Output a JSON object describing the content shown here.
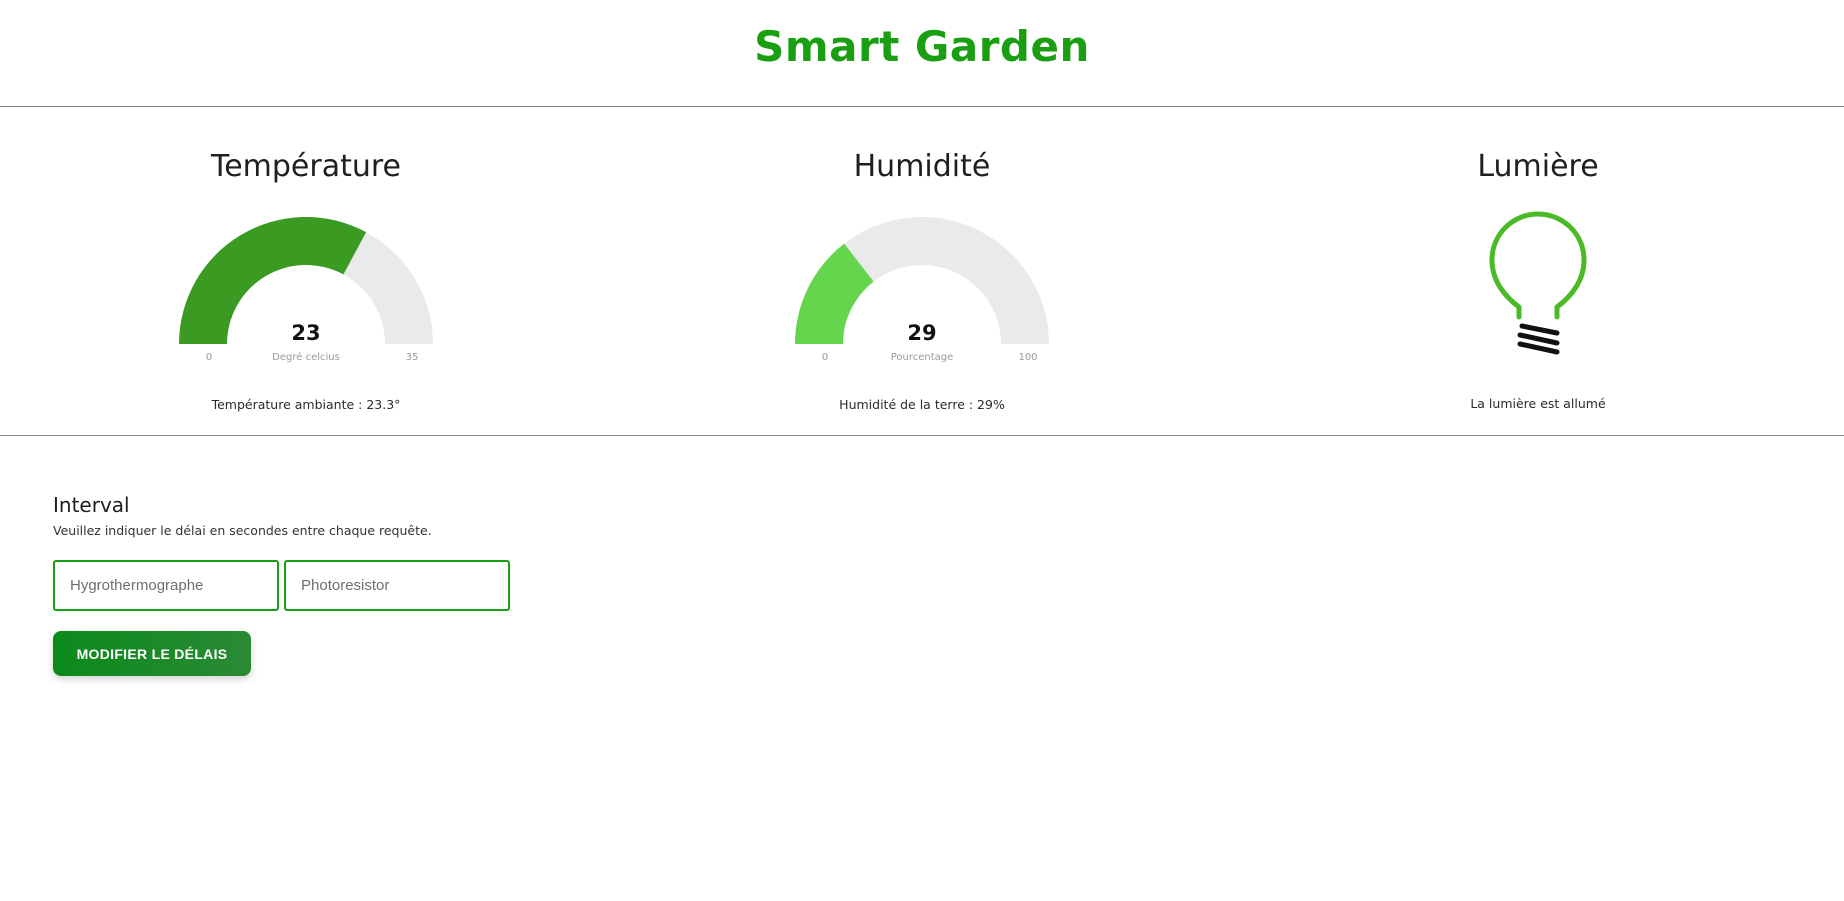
{
  "header": {
    "title": "Smart Garden"
  },
  "temperature": {
    "title": "Température",
    "value": "23",
    "unit": "Degré celcius",
    "min": "0",
    "max": "35",
    "fraction": 0.657,
    "color": "#3a9a22",
    "caption": "Température ambiante : 23.3°"
  },
  "humidity": {
    "title": "Humidité",
    "value": "29",
    "unit": "Pourcentage",
    "min": "0",
    "max": "100",
    "fraction": 0.29,
    "color": "#65d54e",
    "caption": "Humidité de la terre : 29%"
  },
  "light": {
    "title": "Lumière",
    "icon": "light-bulb-icon",
    "on": true,
    "color": "#4bba27",
    "caption": "La lumière est allumé"
  },
  "interval": {
    "title": "Interval",
    "help": "Veuillez indiquer le délai en secondes entre chaque requête.",
    "hygro_placeholder": "Hygrothermographe",
    "photo_placeholder": "Photoresistor",
    "submit_label": "MODIFIER LE DÉLAIS"
  },
  "colors": {
    "brand": "#1a9e12",
    "gauge_track": "#ebeaea"
  }
}
